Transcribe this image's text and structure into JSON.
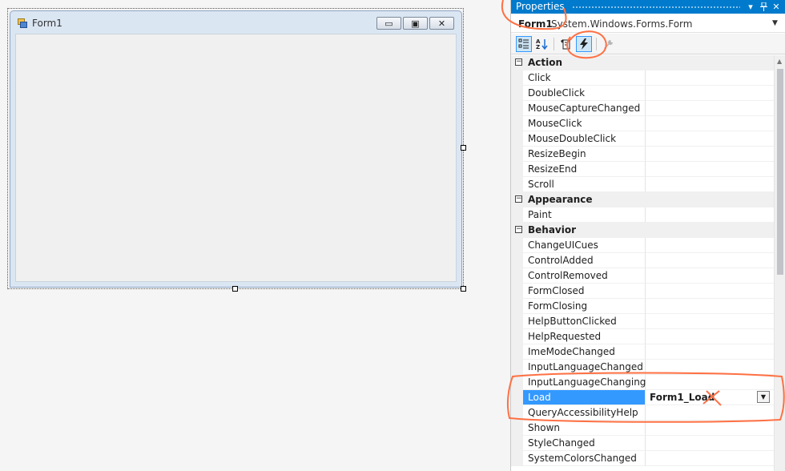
{
  "designer": {
    "form_title": "Form1",
    "caption_buttons": {
      "minimize": "▭",
      "maximize": "▣",
      "close": "✕"
    }
  },
  "properties": {
    "panel_title": "Properties",
    "header_buttons": {
      "dropdown": "▾",
      "pin": "📌",
      "close": "✕"
    },
    "object_name": "Form1",
    "object_type": "System.Windows.Forms.Form",
    "object_dropdown": "▼",
    "toolbar": {
      "categorized_icon": "categorized-icon",
      "alphabetical_icon": "alphabetical-icon",
      "properties_icon": "properties-icon",
      "events_icon": "lightning-icon",
      "property_pages_icon": "wrench-icon"
    },
    "categories": [
      {
        "label": "Action",
        "toggle": "−"
      },
      {
        "label": "Appearance",
        "toggle": "−"
      },
      {
        "label": "Behavior",
        "toggle": "−"
      }
    ],
    "action_events": [
      "Click",
      "DoubleClick",
      "MouseCaptureChanged",
      "MouseClick",
      "MouseDoubleClick",
      "ResizeBegin",
      "ResizeEnd",
      "Scroll"
    ],
    "appearance_events": [
      "Paint"
    ],
    "behavior_events": [
      "ChangeUICues",
      "ControlAdded",
      "ControlRemoved",
      "FormClosed",
      "FormClosing",
      "HelpButtonClicked",
      "HelpRequested",
      "ImeModeChanged",
      "InputLanguageChanged",
      "InputLanguageChanging",
      "Load",
      "QueryAccessibilityHelp",
      "Shown",
      "StyleChanged",
      "SystemColorsChanged"
    ],
    "selected_event": "Load",
    "selected_value": "Form1_Load",
    "value_dropdown": "▼"
  },
  "colors": {
    "accent": "#007acc",
    "selection": "#3399ff",
    "annotation": "#ff7043"
  }
}
